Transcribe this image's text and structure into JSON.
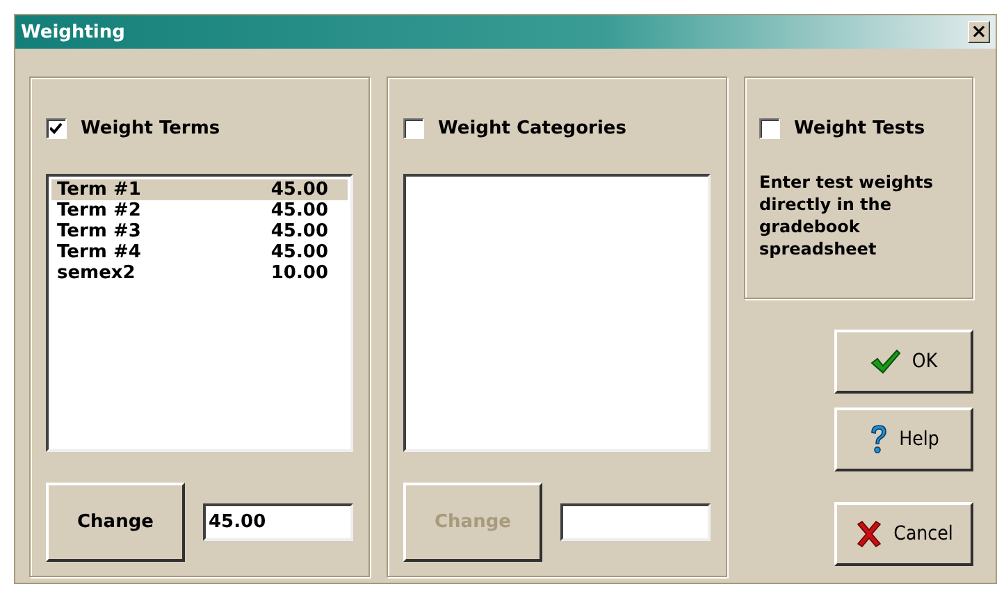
{
  "window": {
    "title": "Weighting",
    "close": "×"
  },
  "panels": [
    {
      "kind": "list",
      "checkbox": {
        "label": "Weight Terms",
        "checked": true
      },
      "items": [
        {
          "name": "Term #1",
          "value": "45.00",
          "selected": true
        },
        {
          "name": "Term #2",
          "value": "45.00",
          "selected": false
        },
        {
          "name": "Term #3",
          "value": "45.00",
          "selected": false
        },
        {
          "name": "Term #4",
          "value": "45.00",
          "selected": false
        },
        {
          "name": "semex2",
          "value": "10.00",
          "selected": false
        }
      ],
      "change_button": {
        "label": "Change",
        "disabled": false
      },
      "value_field": {
        "value": "45.00"
      }
    },
    {
      "kind": "list",
      "checkbox": {
        "label": "Weight Categories",
        "checked": false
      },
      "change_button": {
        "label": "Change",
        "disabled": true
      }
    },
    {
      "kind": "note",
      "checkbox": {
        "label": "Weight Tests",
        "checked": false
      },
      "note": "Enter test weights directly in the gradebook spreadsheet"
    }
  ],
  "buttons": [
    {
      "kind": "ok",
      "label": "OK"
    },
    {
      "kind": "help",
      "label": "Help"
    },
    {
      "kind": "cancel",
      "label": "Cancel"
    }
  ]
}
